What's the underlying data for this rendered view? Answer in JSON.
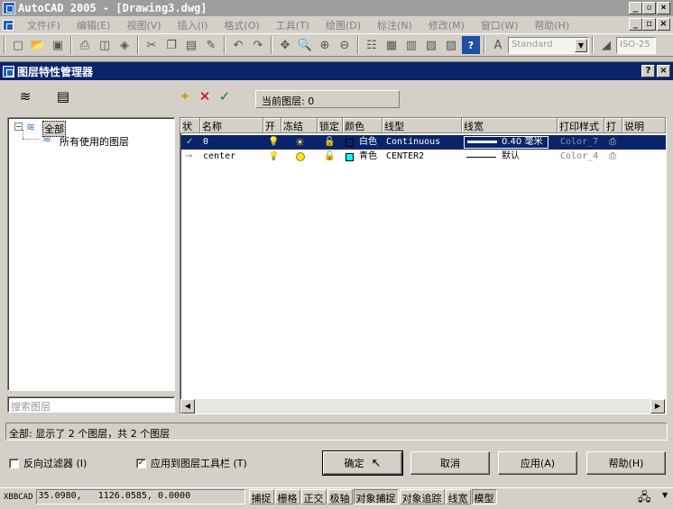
{
  "app": {
    "title": "AutoCAD 2005 - [Drawing3.dwg]"
  },
  "menu": [
    "文件(F)",
    "编辑(E)",
    "视图(V)",
    "插入(I)",
    "格式(O)",
    "工具(T)",
    "绘图(D)",
    "标注(N)",
    "修改(M)",
    "窗口(W)",
    "帮助(H)"
  ],
  "toolbar": {
    "text_style": "Standard",
    "dim_style": "ISO-25"
  },
  "dialog": {
    "title": "图层特性管理器",
    "current_layer_label": "当前图层: 0",
    "tree": {
      "root": "全部",
      "child": "所有使用的图层"
    },
    "search_placeholder": "搜索图层",
    "columns": [
      "状",
      "名称",
      "开",
      "冻结",
      "锁定",
      "颜色",
      "线型",
      "线宽",
      "打印样式",
      "打",
      "说明"
    ],
    "layers": [
      {
        "name": "0",
        "color_name": "白色",
        "color_hex": "#ffffff",
        "linetype": "Continuous",
        "lineweight": "0.40 毫米",
        "plot_style": "Color_7",
        "selected": true
      },
      {
        "name": "center",
        "color_name": "青色",
        "color_hex": "#00ffff",
        "linetype": "CENTER2",
        "lineweight": "默认",
        "plot_style": "Color_4",
        "selected": false
      }
    ],
    "summary": "全部: 显示了 2 个图层，共 2 个图层",
    "invert_filter": "反向过滤器 (I)",
    "apply_toolbar": "应用到图层工具栏 (T)",
    "ok": "确定",
    "cancel": "取消",
    "apply": "应用(A)",
    "help": "帮助(H)"
  },
  "statusbar": {
    "command": "XBBCAD",
    "coords": "35.0980,   1126.0585, 0.0000",
    "modes": [
      "捕捉",
      "栅格",
      "正交",
      "极轴",
      "对象捕捉",
      "对象追踪",
      "线宽",
      "模型"
    ]
  }
}
